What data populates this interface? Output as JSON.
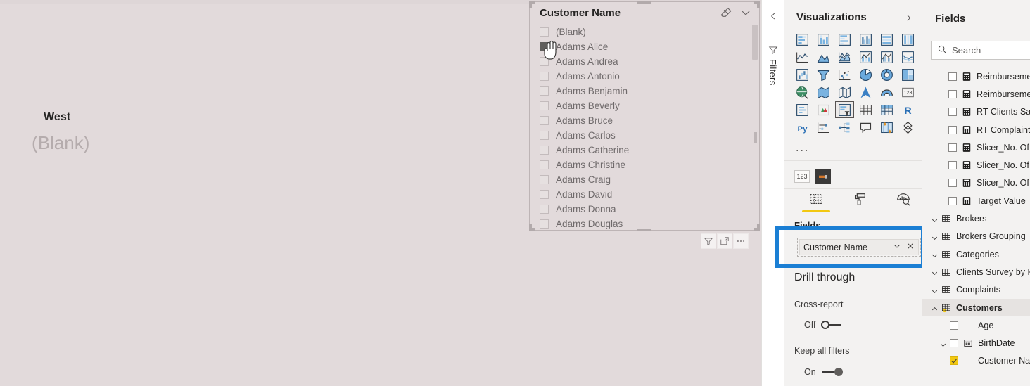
{
  "canvas": {
    "card": {
      "title": "West",
      "value": "(Blank)"
    }
  },
  "slicer": {
    "title": "Customer Name",
    "header_icons": [
      {
        "name": "clear-selections-icon",
        "glyph": "eraser"
      },
      {
        "name": "slicer-dropdown-icon",
        "glyph": "chevron-down"
      }
    ],
    "items": [
      {
        "label": "(Blank)",
        "checked": false,
        "hovered": false
      },
      {
        "label": "Adams Alice",
        "checked": false,
        "hovered": true
      },
      {
        "label": "Adams Andrea",
        "checked": false,
        "hovered": false
      },
      {
        "label": "Adams Antonio",
        "checked": false,
        "hovered": false
      },
      {
        "label": "Adams Benjamin",
        "checked": false,
        "hovered": false
      },
      {
        "label": "Adams Beverly",
        "checked": false,
        "hovered": false
      },
      {
        "label": "Adams Bruce",
        "checked": false,
        "hovered": false
      },
      {
        "label": "Adams Carlos",
        "checked": false,
        "hovered": false
      },
      {
        "label": "Adams Catherine",
        "checked": false,
        "hovered": false
      },
      {
        "label": "Adams Christine",
        "checked": false,
        "hovered": false
      },
      {
        "label": "Adams Craig",
        "checked": false,
        "hovered": false
      },
      {
        "label": "Adams David",
        "checked": false,
        "hovered": false
      },
      {
        "label": "Adams Donna",
        "checked": false,
        "hovered": false
      },
      {
        "label": "Adams Douglas",
        "checked": false,
        "hovered": false
      }
    ],
    "actions": [
      {
        "name": "filter-icon",
        "label": "Filters"
      },
      {
        "name": "focus-mode-icon",
        "label": "Focus mode"
      },
      {
        "name": "more-options-icon",
        "label": "More options"
      }
    ]
  },
  "visualizations": {
    "collapse_icon": "chevron-left-icon",
    "filters_label": "Filters",
    "title": "Visualizations",
    "expand_icon": "chevron-right-icon",
    "more_icon_label": "...",
    "icons": [
      "stacked-bar-chart",
      "stacked-column-chart",
      "clustered-bar-chart",
      "clustered-column-chart",
      "100-stacked-bar-chart",
      "100-stacked-column-chart",
      "line-chart",
      "area-chart",
      "stacked-area-chart",
      "line-stacked-column-chart",
      "line-clustered-column-chart",
      "ribbon-chart",
      "waterfall-chart",
      "funnel-chart",
      "scatter-chart",
      "pie-chart",
      "donut-chart",
      "treemap",
      "map",
      "filled-map",
      "shape-map",
      "azure-map",
      "arcgis-map",
      "card",
      "multi-row-card",
      "kpi",
      "slicer",
      "table",
      "matrix",
      "r-visual",
      "py-visual",
      "key-influencers",
      "decomposition-tree",
      "qa-visual",
      "smart-narrative",
      "paginated-report"
    ],
    "selected_icon": "slicer",
    "custom_visuals": [
      {
        "name": "number-format-visual",
        "label": "123"
      },
      {
        "name": "dark-custom-visual",
        "label": ""
      }
    ],
    "tabs": [
      {
        "name": "fields-tab",
        "icon": "fields-grid-icon",
        "active": true
      },
      {
        "name": "format-tab",
        "icon": "paint-roller-icon",
        "active": false
      },
      {
        "name": "analytics-tab",
        "icon": "magnifier-analytics-icon",
        "active": false
      }
    ],
    "wells_label": "Fields",
    "field_well": {
      "value": "Customer Name",
      "dropdown_icon": "chevron-down-icon",
      "remove_icon": "close-icon"
    },
    "drill_through": {
      "title": "Drill through",
      "cross_report": {
        "label": "Cross-report",
        "state": "Off",
        "on": false
      },
      "keep_all_filters": {
        "label": "Keep all filters",
        "state": "On",
        "on": true
      }
    }
  },
  "fields": {
    "title": "Fields",
    "search": {
      "placeholder": "Search",
      "value": "",
      "icon": "search-icon"
    },
    "items": [
      {
        "label": "Reimbursements",
        "type": "measure",
        "checked": false,
        "level": "field",
        "expand": "none"
      },
      {
        "label": "Reimbursements",
        "type": "measure",
        "checked": false,
        "level": "field",
        "expand": "none"
      },
      {
        "label": "RT Clients Satisfa",
        "type": "measure",
        "checked": false,
        "level": "field",
        "expand": "none"
      },
      {
        "label": "RT Complaints",
        "type": "measure",
        "checked": false,
        "level": "field",
        "expand": "none"
      },
      {
        "label": "Slicer_No. Of Bro",
        "type": "measure",
        "checked": false,
        "level": "field",
        "expand": "none"
      },
      {
        "label": "Slicer_No. Of Cu",
        "type": "measure",
        "checked": false,
        "level": "field",
        "expand": "none"
      },
      {
        "label": "Slicer_No. Of Re",
        "type": "measure",
        "checked": false,
        "level": "field",
        "expand": "none"
      },
      {
        "label": "Target Value",
        "type": "measure",
        "checked": false,
        "level": "field",
        "expand": "none"
      },
      {
        "label": "Brokers",
        "type": "table",
        "checked": false,
        "level": "table",
        "expand": "collapsed"
      },
      {
        "label": "Brokers Grouping",
        "type": "table",
        "checked": false,
        "level": "table",
        "expand": "collapsed"
      },
      {
        "label": "Categories",
        "type": "table",
        "checked": false,
        "level": "table",
        "expand": "collapsed"
      },
      {
        "label": "Clients Survey by Pr",
        "type": "table",
        "checked": false,
        "level": "table",
        "expand": "collapsed"
      },
      {
        "label": "Complaints",
        "type": "table",
        "checked": false,
        "level": "table",
        "expand": "collapsed"
      },
      {
        "label": "Customers",
        "type": "table-used",
        "checked": false,
        "level": "table",
        "expand": "expanded",
        "highlight": true,
        "bold": true
      },
      {
        "label": "Age",
        "type": "plain",
        "checked": false,
        "level": "sub",
        "expand": "none"
      },
      {
        "label": "BirthDate",
        "type": "date",
        "checked": false,
        "level": "sub",
        "expand": "collapsed"
      },
      {
        "label": "Customer Name",
        "type": "plain",
        "checked": true,
        "level": "sub",
        "expand": "none"
      }
    ]
  }
}
